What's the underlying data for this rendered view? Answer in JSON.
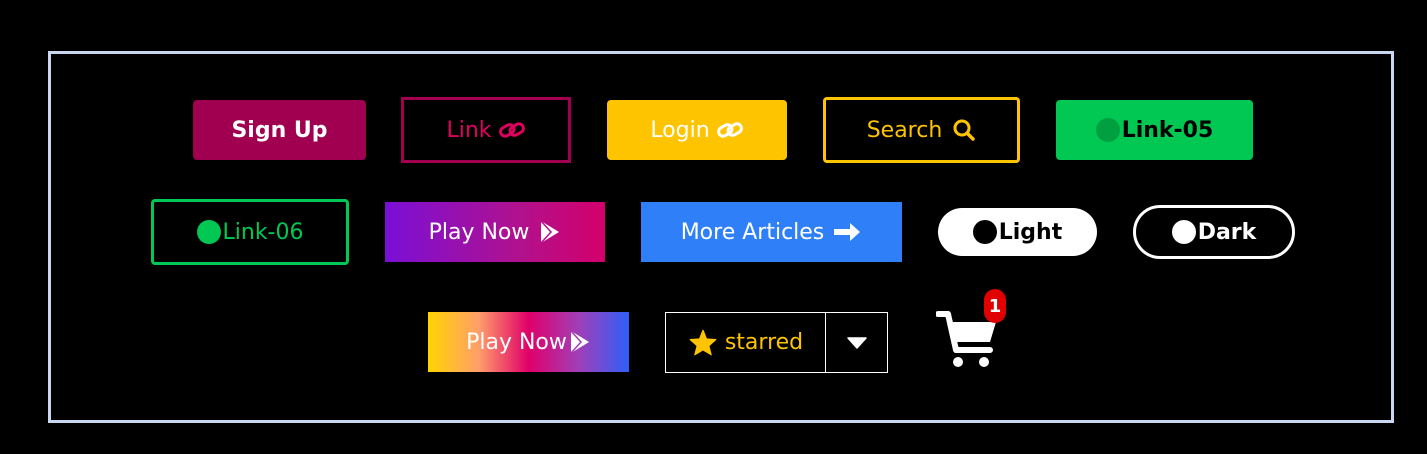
{
  "colors": {
    "crimson": "#a0004f",
    "amber": "#ffc400",
    "green": "#00c853",
    "blue": "#2f80f8",
    "badge_red": "#e00000"
  },
  "buttons": {
    "sign_up": "Sign Up",
    "link": "Link",
    "login": "Login",
    "search": "Search",
    "link_05": "Link-05",
    "link_06": "Link-06",
    "play_now": "Play Now",
    "more_articles": "More Articles",
    "light": "Light",
    "dark": "Dark",
    "play_now_2": "Play Now",
    "starred": "starred"
  },
  "cart": {
    "count": "1"
  },
  "icons": [
    "link-icon",
    "search-icon",
    "play-icon",
    "arrow-right-icon",
    "star-icon",
    "caret-down-icon",
    "cart-icon",
    "dot-icon"
  ]
}
